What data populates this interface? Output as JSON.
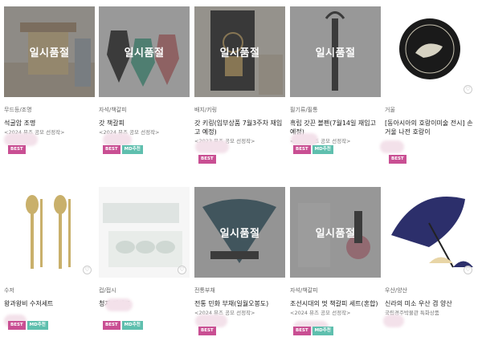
{
  "soldout_label": "일시품절",
  "heart_glyph": "♡",
  "colors": {
    "best": "#c94f93",
    "md": "#5fbfae",
    "soldout_overlay": "#505050"
  },
  "products": [
    {
      "category": "무드등/조명",
      "name": "석굴암 조명",
      "subtitle": "<2024 뮤즈 공모 선정작>",
      "soldout": true,
      "badges": [
        "BEST"
      ]
    },
    {
      "category": "자석/책갈피",
      "name": "갓 책갈피",
      "subtitle": "<2024 뮤즈 공모 선정작>",
      "soldout": true,
      "badges": [
        "BEST",
        "MD추천"
      ]
    },
    {
      "category": "배지/키링",
      "name": "갓 키링(입부상품 7월3주차 재입고 예정)",
      "subtitle": "<2023 뮤즈 공모 선정작>",
      "soldout": true,
      "badges": [
        "BEST"
      ]
    },
    {
      "category": "필기류/필통",
      "name": "흑립 갓끈 볼펜(7월14일 재입고 예정)",
      "subtitle": "<2024 뮤즈 공모 선정작>",
      "soldout": true,
      "badges": [
        "BEST",
        "MD추천"
      ]
    },
    {
      "category": "거울",
      "name": "[동아시아의 호랑이미술 전시] 손거울 나전 호랑이",
      "subtitle": "",
      "soldout": false,
      "badges": [
        "BEST"
      ]
    },
    {
      "category": "수저",
      "name": "왕과왕비 수저세트",
      "subtitle": "",
      "soldout": false,
      "badges": [
        "BEST",
        "MD추천"
      ]
    },
    {
      "category": "컵/접시",
      "name": "청자 잔세트",
      "subtitle": "",
      "soldout": false,
      "badges": [
        "BEST",
        "MD추천"
      ]
    },
    {
      "category": "전통부채",
      "name": "전통 민화 부채(일월오봉도)",
      "subtitle": "<2024 뮤즈 공모 선정작>",
      "soldout": true,
      "badges": [
        "BEST"
      ]
    },
    {
      "category": "자석/책갈피",
      "name": "조선시대의 멋 책갈피 세트(혼합)",
      "subtitle": "<2024 뮤즈 공모 선정작>",
      "soldout": true,
      "badges": [
        "BEST",
        "MD추천"
      ]
    },
    {
      "category": "우산/양산",
      "name": "신라의 미소 우산 겸 양산",
      "subtitle": "국립경주박물관 특화상품",
      "soldout": false,
      "badges": []
    }
  ]
}
